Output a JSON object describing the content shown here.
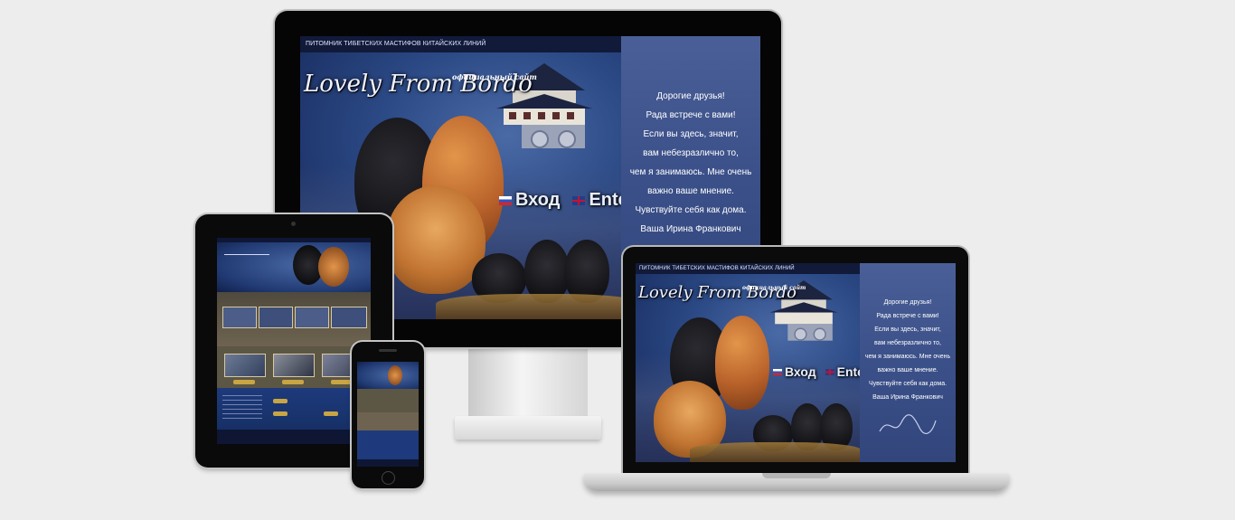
{
  "site": {
    "topbar": "ПИТОМНИК ТИБЕТСКИХ МАСТИФОВ КИТАЙСКИХ ЛИНИЙ",
    "logo": "Lovely From Bordo",
    "official": "официальный сайт",
    "enter_ru": "Вход",
    "enter_en": "Enter",
    "welcome": [
      "Дорогие друзья!",
      "Рада встрече с вами!",
      "Если вы здесь, значит,",
      "вам небезразлично то,",
      "чем я занимаюсь. Мне очень",
      "важно ваше мнение.",
      "Чувствуйте себя как дома.",
      "Ваша Ирина Франкович"
    ]
  },
  "icons": {
    "flag_ru": "russia-flag-icon",
    "flag_en": "uk-flag-icon",
    "signature": "signature-icon"
  },
  "colors": {
    "page_bg": "#ededed",
    "site_blue": "#2c4a86",
    "welcome_panel": "#3b5089",
    "gold_accent": "#c9a544"
  }
}
